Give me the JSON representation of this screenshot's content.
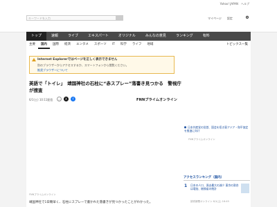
{
  "topbar": {
    "links": [
      "Yahoo! JAPAN",
      "ヘルプ"
    ]
  },
  "header": {
    "search_placeholder": "キーワードを入力",
    "links": [
      "マイページ",
      "設定"
    ]
  },
  "nav_main": [
    "トップ",
    "速報",
    "ライブ",
    "エキスパート",
    "オリジナル",
    "みんなの意見",
    "ランキング",
    "有料"
  ],
  "nav_sub": [
    "主要",
    "国内",
    "国際",
    "経済",
    "エンタメ",
    "スポーツ",
    "IT",
    "科学",
    "ライフ",
    "地域"
  ],
  "nav_sub_right": "トピックス一覧",
  "warning": {
    "title": "Internet Explorerではページを正しく表示できません",
    "text": "別のブラウザーからアクセスするか、スマートフォンから閲覧ください。",
    "link": "推奨ブラウザーについて"
  },
  "article": {
    "title": "英語で「トイレ」　靖国神社の石柱に“赤スプレー”落書き見つかる　警視庁が捜査",
    "date": "6/1(土) 10:11配信",
    "publisher": "FNNプライムオンライン",
    "source": "FNNプライムオンライン",
    "lead": "靖国神社で1日朝早く、石柱にスプレーで書かれた落書きが見つかったことがわかった。"
  },
  "side": {
    "text": "日本共産党の党首、国会を招き東アジア・和平協定を推進に向け",
    "source": "FNNプライムオンライン"
  },
  "ranking": {
    "title": "アクセスランキング（国内）",
    "items": [
      {
        "rank": "1",
        "text": "日本の人口、過去最大の減少 東京の割合は増加、総務省の統計",
        "source": "読売新聞オンライン 6/1(土) 16:49"
      }
    ]
  },
  "colors": {
    "nav": "#494949",
    "link": "#1a4fa0",
    "warning_border": "#e8b84d",
    "x": "#111111",
    "facebook": "#1877f2"
  }
}
